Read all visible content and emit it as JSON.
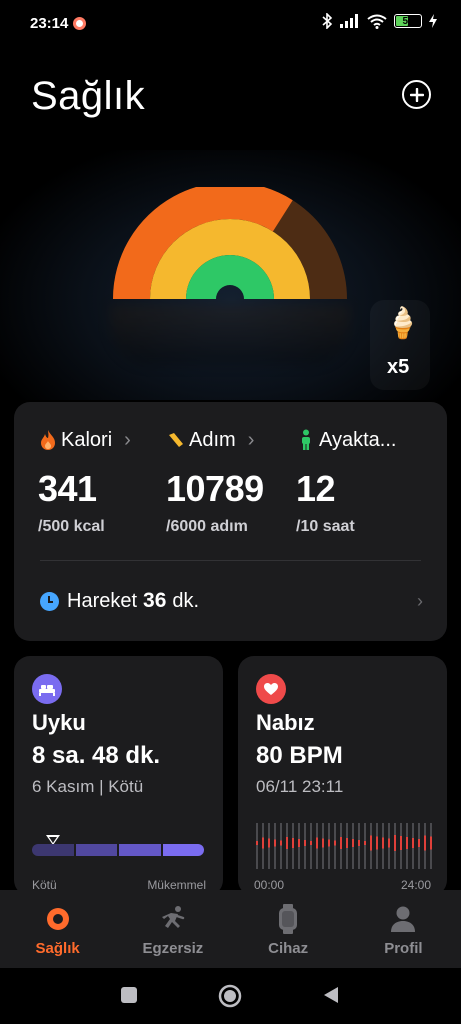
{
  "status_bar": {
    "time": "23:14",
    "battery_level": "52",
    "battery_fraction": 0.52,
    "icons": [
      "bluetooth-icon",
      "signal-icon",
      "wifi-icon",
      "battery-icon",
      "charging-icon"
    ]
  },
  "header": {
    "title": "Sağlık",
    "add_icon": "plus-circle-icon"
  },
  "rings": {
    "outer_color": "#f26a1b",
    "outer_track_color": "#4d2c14",
    "middle_color": "#f5b82e",
    "inner_color": "#2ec866",
    "outer_progress": 0.68,
    "middle_progress": 1.0,
    "inner_progress": 1.0
  },
  "treat": {
    "icon": "ice-cream-icon",
    "count": "x5"
  },
  "activity": {
    "metrics": [
      {
        "label": "Kalori",
        "value": "341",
        "goal": "/500 kcal",
        "icon": "flame-icon",
        "color": "#f26a1b"
      },
      {
        "label": "Adım",
        "value": "10789",
        "goal": "/6000 adım",
        "icon": "shoe-icon",
        "color": "#f5b82e"
      },
      {
        "label": "Ayakta...",
        "value": "12",
        "goal": "/10 saat",
        "icon": "person-standing-icon",
        "color": "#2ec866"
      }
    ],
    "move": {
      "label": "Hareket",
      "value": "36",
      "unit": "dk."
    }
  },
  "sleep": {
    "title": "Uyku",
    "value": "8 sa. 48 dk.",
    "subtitle": "6 Kasım | Kötü",
    "scale_left": "Kötü",
    "scale_right": "Mükemmel",
    "icon": "bed-icon",
    "color": "#7a6cf0"
  },
  "heart_rate": {
    "title": "Nabız",
    "value": "80 BPM",
    "subtitle": "06/11 23:11",
    "scale_left": "00:00",
    "scale_right": "24:00",
    "icon": "heart-icon",
    "color": "#ef4a4a"
  },
  "bottom_nav": {
    "items": [
      {
        "label": "Sağlık",
        "icon": "health-ring-icon",
        "active": true
      },
      {
        "label": "Egzersiz",
        "icon": "running-icon",
        "active": false
      },
      {
        "label": "Cihaz",
        "icon": "watch-icon",
        "active": false
      },
      {
        "label": "Profil",
        "icon": "profile-icon",
        "active": false
      }
    ]
  },
  "system_nav": {
    "buttons": [
      "recent-apps-icon",
      "home-icon",
      "back-icon"
    ]
  }
}
